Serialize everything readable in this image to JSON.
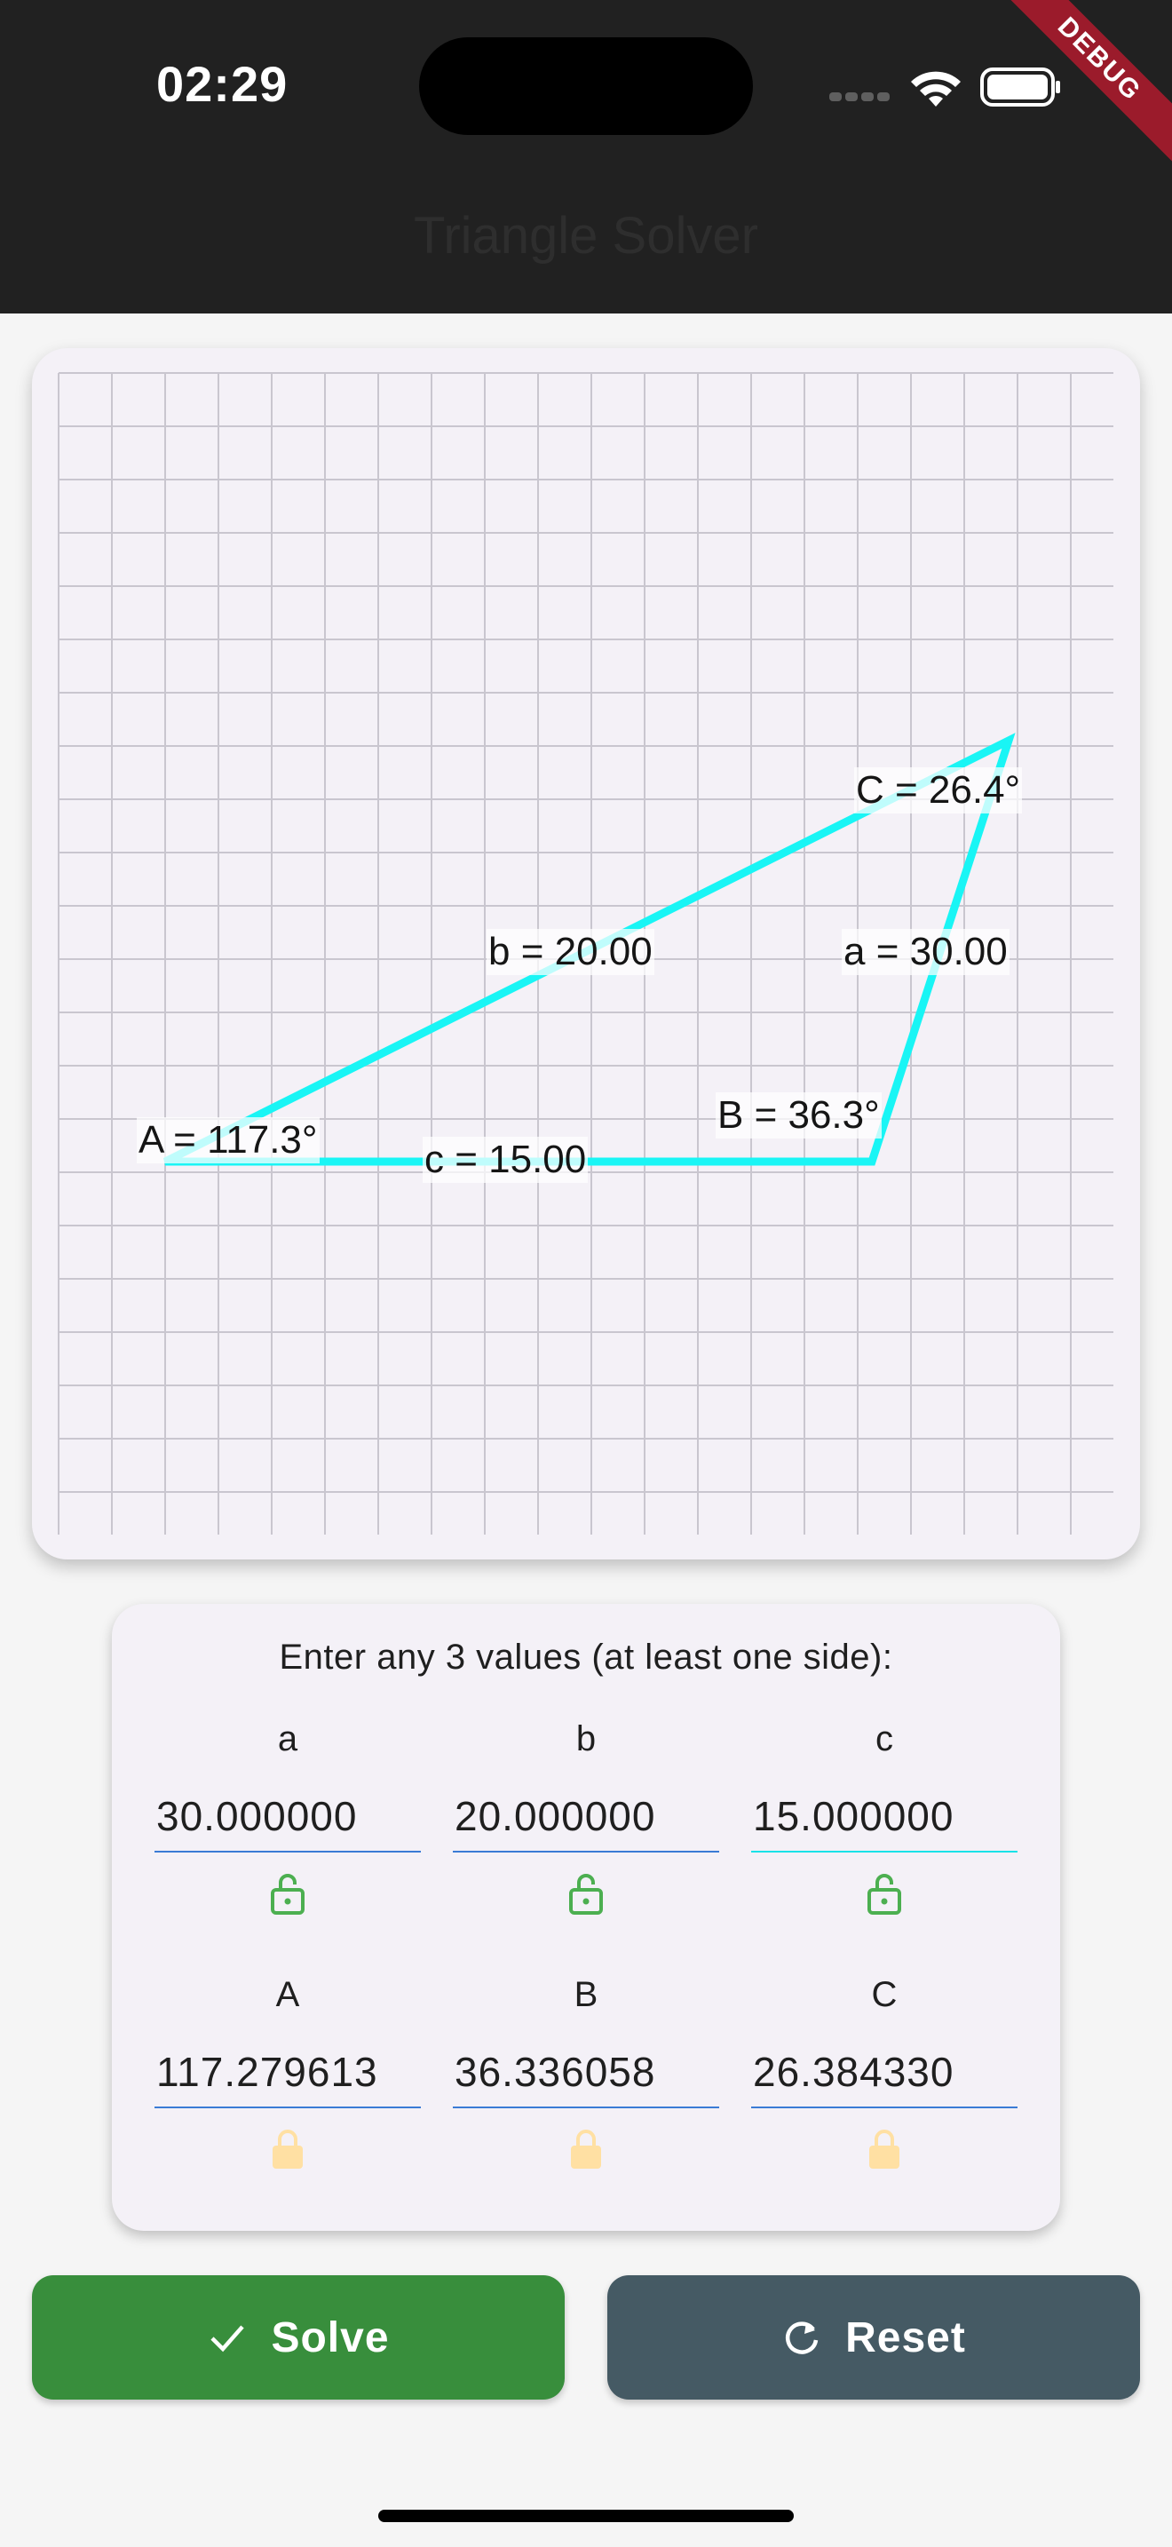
{
  "status_bar": {
    "time": "02:29",
    "debug_banner": "DEBUG"
  },
  "app_bar": {
    "title": "Triangle Solver"
  },
  "triangle": {
    "side_a": "a = 30.00",
    "side_b": "b = 20.00",
    "side_c": "c = 15.00",
    "angle_A": "A = 117.3°",
    "angle_B": "B = 36.3°",
    "angle_C": "C = 26.4°",
    "line_color": "#19f5f5",
    "grid_color": "#c9c6cf"
  },
  "inputs": {
    "instructions": "Enter any 3 values (at least one side):",
    "fields": [
      {
        "label": "a",
        "value": "30.000000",
        "locked": false
      },
      {
        "label": "b",
        "value": "20.000000",
        "locked": false
      },
      {
        "label": "c",
        "value": "15.000000",
        "locked": false
      },
      {
        "label": "A",
        "value": "117.279613",
        "locked": true
      },
      {
        "label": "B",
        "value": "36.336058",
        "locked": true
      },
      {
        "label": "C",
        "value": "26.384330",
        "locked": true
      }
    ],
    "unlock_color": "#4caf50",
    "lock_color": "#ffe0a3"
  },
  "actions": {
    "solve_label": "Solve",
    "reset_label": "Reset",
    "solve_color": "#388e3c",
    "reset_color": "#455a64"
  }
}
